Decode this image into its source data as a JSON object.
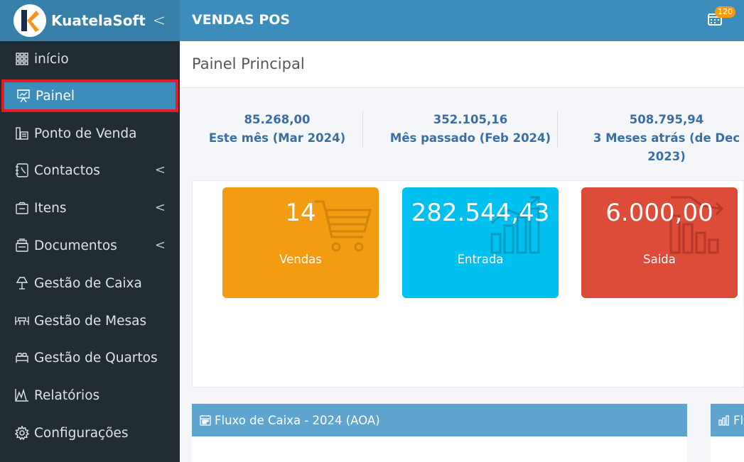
{
  "header": {
    "brand_name": "KuatelaSoft",
    "brand_chevron": "<",
    "app_title": "VENDAS POS",
    "notification_count": "120",
    "colors": {
      "header": "#3c8dbc",
      "brand_bg": "#367fa9",
      "logo_accent": "#f7931e",
      "logo_dark": "#1a2a4f"
    }
  },
  "sidebar": {
    "items": [
      {
        "label": "início",
        "icon": "dashboard-grid-icon",
        "has_submenu": false
      },
      {
        "label": "Painel",
        "icon": "presentation-icon",
        "has_submenu": false,
        "active": true
      },
      {
        "label": "Ponto de Venda",
        "icon": "pos-terminal-icon",
        "has_submenu": false
      },
      {
        "label": "Contactos",
        "icon": "contact-book-icon",
        "has_submenu": true
      },
      {
        "label": "Itens",
        "icon": "box-icon",
        "has_submenu": true
      },
      {
        "label": "Documentos",
        "icon": "documents-icon",
        "has_submenu": true
      },
      {
        "label": "Gestão de Caixa",
        "icon": "lamp-icon",
        "has_submenu": false
      },
      {
        "label": "Gestão de Mesas",
        "icon": "tables-icon",
        "has_submenu": false
      },
      {
        "label": "Gestão de Quartos",
        "icon": "bed-icon",
        "has_submenu": false
      },
      {
        "label": "Relatórios",
        "icon": "chart-icon",
        "has_submenu": false
      },
      {
        "label": "Configurações",
        "icon": "gear-icon",
        "has_submenu": false
      }
    ],
    "submenu_chevron": "<"
  },
  "main": {
    "page_title": "Painel Principal",
    "stats": [
      {
        "value": "85.268,00",
        "label": "Este mês (Mar 2024)"
      },
      {
        "value": "352.105,16",
        "label": "Mês passado (Feb 2024)"
      },
      {
        "value": "508.795,94",
        "label_line1": "3 Meses atrás (de Dec",
        "label_line2": "2023)"
      }
    ],
    "tiles": [
      {
        "value": "14",
        "label": "Vendas",
        "color": "#f39c12",
        "icon": "shopping-cart-icon"
      },
      {
        "value": "282.544,43",
        "label": "Entrada",
        "color": "#00c0ef",
        "icon": "bar-chart-up-icon"
      },
      {
        "value": "6.000,00",
        "label": "Saida",
        "color": "#dd4b39",
        "icon": "bar-chart-down-icon"
      }
    ],
    "cash_flow_box": {
      "title": "Fluxo de Caixa - 2024 (AOA)",
      "icon": "calendar-icon"
    },
    "second_box": {
      "title": "Fl",
      "icon": "bar-chart-icon"
    }
  }
}
